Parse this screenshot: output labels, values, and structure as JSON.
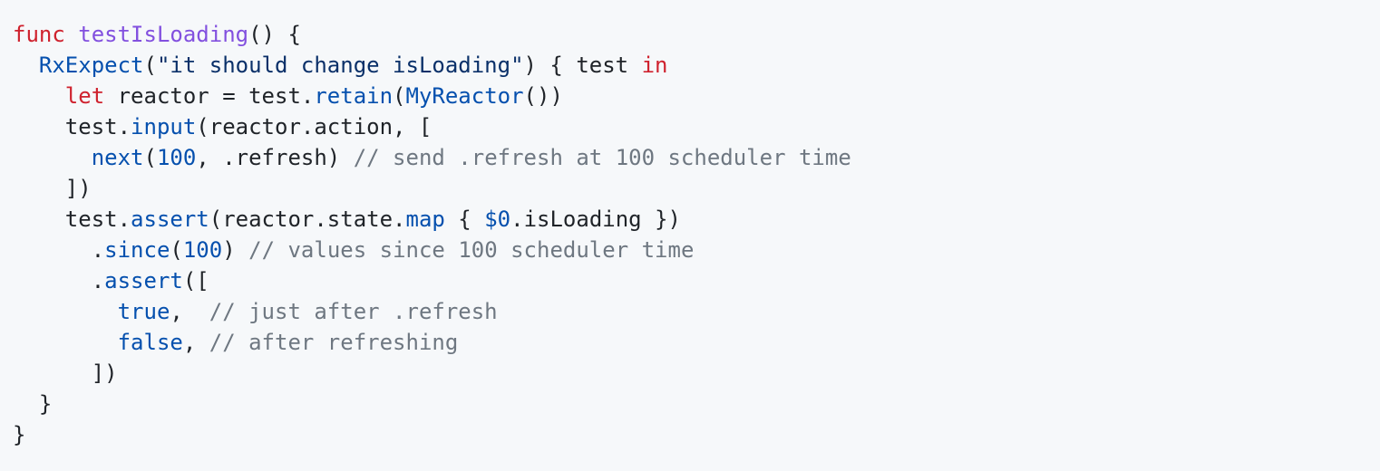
{
  "code": {
    "lines": [
      [
        {
          "t": "func",
          "c": "kw"
        },
        {
          "t": " ",
          "c": "pl"
        },
        {
          "t": "testIsLoading",
          "c": "fn"
        },
        {
          "t": "() {",
          "c": "pl"
        }
      ],
      [
        {
          "t": "  ",
          "c": "pl"
        },
        {
          "t": "RxExpect",
          "c": "call"
        },
        {
          "t": "(",
          "c": "pl"
        },
        {
          "t": "\"it should change isLoading\"",
          "c": "str"
        },
        {
          "t": ") { test ",
          "c": "pl"
        },
        {
          "t": "in",
          "c": "kw"
        }
      ],
      [
        {
          "t": "    ",
          "c": "pl"
        },
        {
          "t": "let",
          "c": "kw"
        },
        {
          "t": " reactor = test.",
          "c": "pl"
        },
        {
          "t": "retain",
          "c": "call"
        },
        {
          "t": "(",
          "c": "pl"
        },
        {
          "t": "MyReactor",
          "c": "call"
        },
        {
          "t": "())",
          "c": "pl"
        }
      ],
      [
        {
          "t": "    test.",
          "c": "pl"
        },
        {
          "t": "input",
          "c": "call"
        },
        {
          "t": "(reactor.action, [",
          "c": "pl"
        }
      ],
      [
        {
          "t": "      ",
          "c": "pl"
        },
        {
          "t": "next",
          "c": "call"
        },
        {
          "t": "(",
          "c": "pl"
        },
        {
          "t": "100",
          "c": "num"
        },
        {
          "t": ", .refresh) ",
          "c": "pl"
        },
        {
          "t": "// send .refresh at 100 scheduler time",
          "c": "cmt"
        }
      ],
      [
        {
          "t": "    ])",
          "c": "pl"
        }
      ],
      [
        {
          "t": "    test.",
          "c": "pl"
        },
        {
          "t": "assert",
          "c": "call"
        },
        {
          "t": "(reactor.state.",
          "c": "pl"
        },
        {
          "t": "map",
          "c": "call"
        },
        {
          "t": " { ",
          "c": "pl"
        },
        {
          "t": "$0",
          "c": "call"
        },
        {
          "t": ".isLoading })",
          "c": "pl"
        }
      ],
      [
        {
          "t": "      .",
          "c": "pl"
        },
        {
          "t": "since",
          "c": "call"
        },
        {
          "t": "(",
          "c": "pl"
        },
        {
          "t": "100",
          "c": "num"
        },
        {
          "t": ") ",
          "c": "pl"
        },
        {
          "t": "// values since 100 scheduler time",
          "c": "cmt"
        }
      ],
      [
        {
          "t": "      .",
          "c": "pl"
        },
        {
          "t": "assert",
          "c": "call"
        },
        {
          "t": "([",
          "c": "pl"
        }
      ],
      [
        {
          "t": "        ",
          "c": "pl"
        },
        {
          "t": "true",
          "c": "call"
        },
        {
          "t": ",  ",
          "c": "pl"
        },
        {
          "t": "// just after .refresh",
          "c": "cmt"
        }
      ],
      [
        {
          "t": "        ",
          "c": "pl"
        },
        {
          "t": "false",
          "c": "call"
        },
        {
          "t": ", ",
          "c": "pl"
        },
        {
          "t": "// after refreshing",
          "c": "cmt"
        }
      ],
      [
        {
          "t": "      ])",
          "c": "pl"
        }
      ],
      [
        {
          "t": "  }",
          "c": "pl"
        }
      ],
      [
        {
          "t": "}",
          "c": "pl"
        }
      ]
    ]
  }
}
